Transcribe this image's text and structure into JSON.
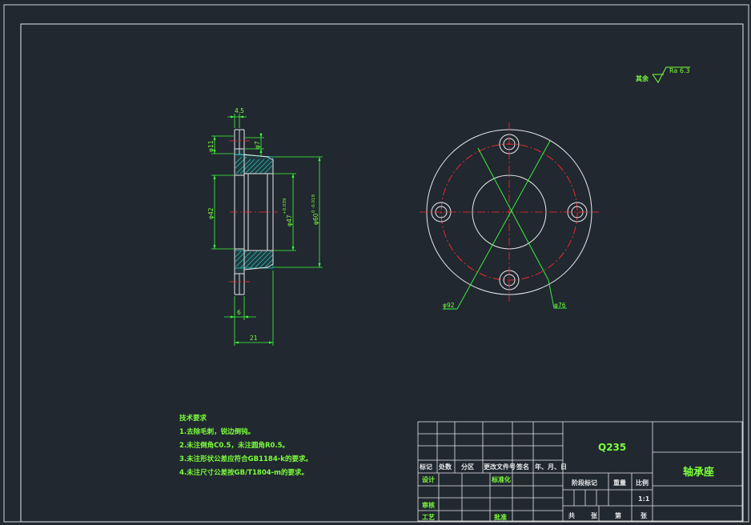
{
  "roughness": {
    "prefix": "其余",
    "value": "Ra 6.3"
  },
  "dimensions": {
    "d45": "4.5",
    "d11": "φ11",
    "d7": "φ7",
    "d42": "φ42",
    "d47": "φ47",
    "tol47": "+0.039",
    "d60": "φ60",
    "tol60": "0 -0.019",
    "d6": "6",
    "d21": "21",
    "d92": "φ92",
    "d76": "φ76"
  },
  "tech_requirements": {
    "title": "技术要求",
    "items": [
      "1.去除毛刺，锐边倒钝。",
      "2.未注倒角C0.5，未注圆角R0.5。",
      "3.未注形状公差应符合GB1184-k的要求。",
      "4.未注尺寸公差按GB/T1804-m的要求。"
    ]
  },
  "title_block": {
    "material": "Q235",
    "part_name": "轴承座",
    "row_headers": [
      "标记",
      "处数",
      "分区",
      "更改文件号",
      "签名",
      "年、月、日"
    ],
    "design": "设计",
    "standardize": "标准化",
    "stage_mark": "阶段标记",
    "weight": "重量",
    "scale": "比例",
    "scale_value": "1:1",
    "review": "审核",
    "process": "工艺",
    "approve": "批准",
    "total": "共",
    "sheets": "张",
    "page": "第",
    "sheets2": "张"
  },
  "colors": {
    "background": "#212830",
    "lines": "#e8e8e8",
    "dimension": "#3cff3c",
    "centerline": "#ff2a2a",
    "hatch": "#2fc8c8"
  }
}
